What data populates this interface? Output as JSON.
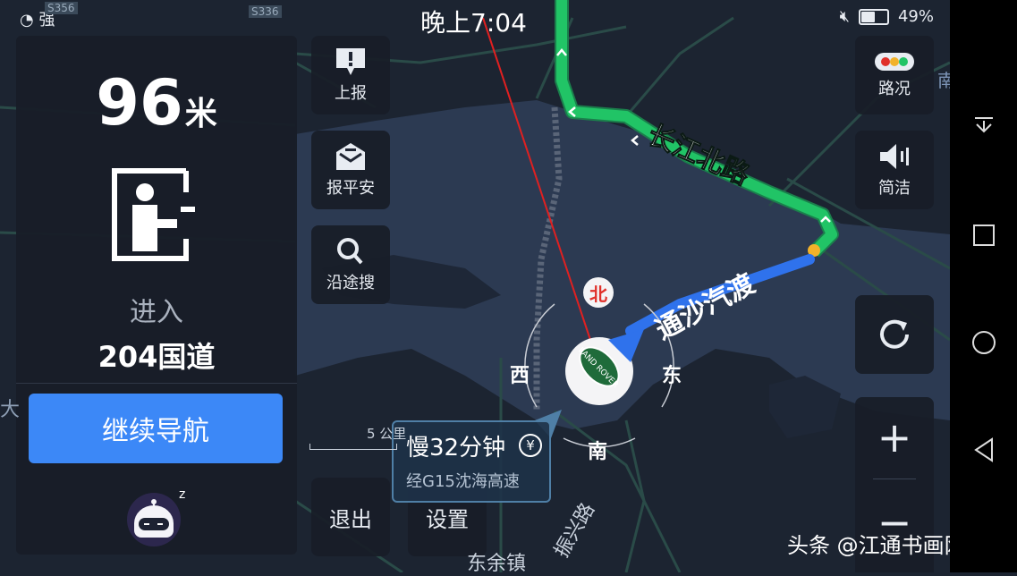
{
  "status_bar": {
    "signal_label": "强",
    "time": "晚上7:04",
    "battery": "49%",
    "battery_level": 0.49
  },
  "guidance": {
    "distance_value": "96",
    "distance_unit": "米",
    "maneuver_icon": "toll-gate-icon",
    "action": "进入",
    "road_name": "204国道",
    "continue_button": "继续导航",
    "assistant_icon": "sleeping-robot-icon",
    "assistant_badge": "z"
  },
  "left_tools": [
    {
      "label": "上报",
      "icon": "report-bubble-icon"
    },
    {
      "label": "报平安",
      "icon": "safety-envelope-icon"
    },
    {
      "label": "沿途搜",
      "icon": "search-icon"
    }
  ],
  "right_tools": [
    {
      "label": "路况",
      "icon": "traffic-light-icon"
    },
    {
      "label": "简洁",
      "icon": "speaker-icon"
    }
  ],
  "refresh_icon": "refresh-icon",
  "zoom": {
    "plus": "+",
    "minus": "−"
  },
  "bottom_buttons": {
    "exit": "退出",
    "settings": "设置"
  },
  "map": {
    "compass": {
      "north": "北",
      "south": "南",
      "east": "东",
      "west": "西"
    },
    "road_label_1": "长江北路",
    "road_label_2": "通沙汽渡",
    "road_label_3": "振兴路",
    "town_label": "东余镇",
    "route_marker_1": "S356",
    "route_marker_2": "S336",
    "edge_label_left": "大",
    "edge_label_right": "南",
    "scale": "5 公里",
    "vehicle_logo": "LAND ROVER"
  },
  "alert": {
    "title": "慢32分钟",
    "yen": "¥",
    "subtitle": "经G15沈海高速"
  },
  "android_nav": {
    "icons": [
      "notification-pull-icon",
      "recents-square-icon",
      "home-circle-icon",
      "back-triangle-icon"
    ]
  },
  "watermark": "头条 @江通书画网",
  "colors": {
    "route_green": "#21c466",
    "route_blue": "#2f72ec",
    "button_blue": "#3c88f7",
    "north_red": "#e0302a",
    "map_bg": "#1c2431",
    "water": "#2c3a52"
  }
}
